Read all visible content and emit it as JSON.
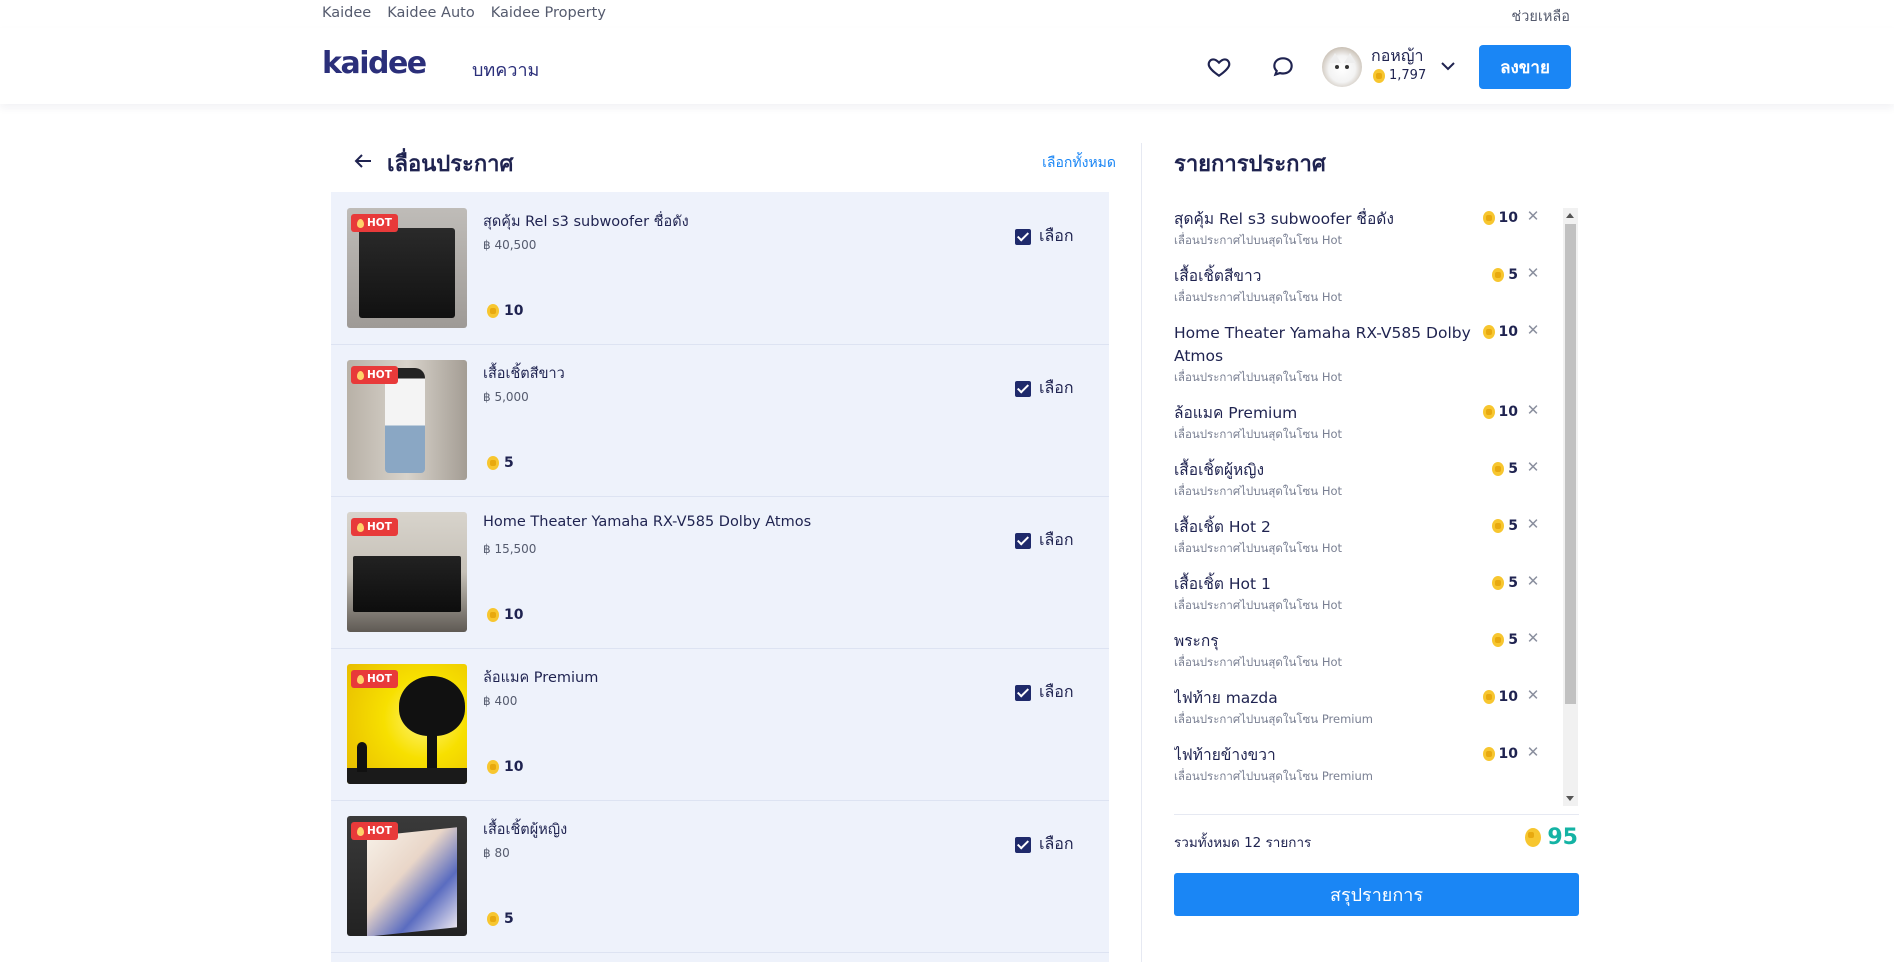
{
  "topbar": {
    "links": [
      "Kaidee",
      "Kaidee Auto",
      "Kaidee Property"
    ],
    "help": "ช่วยเหลือ"
  },
  "header": {
    "logo": "kaidee",
    "nav_articles": "บทความ",
    "user_name": "กอหญ้า",
    "user_coins": "1,797",
    "post_button": "ลงขาย",
    "icons": [
      "heart-icon",
      "chat-icon",
      "chevron-down-icon"
    ]
  },
  "left": {
    "title": "เลื่อนประกาศ",
    "select_all": "เลือกทั้งหมด",
    "items": [
      {
        "title": "สุดคุ้ม Rel s3 subwoofer ชื่อดัง",
        "price": "฿ 40,500",
        "coins": "10",
        "badge": "HOT",
        "check_label": "เลือก",
        "checked": true
      },
      {
        "title": "เสื้อเชิ้ตสีขาว",
        "price": "฿ 5,000",
        "coins": "5",
        "badge": "HOT",
        "check_label": "เลือก",
        "checked": true
      },
      {
        "title": "Home Theater Yamaha RX-V585 Dolby Atmos",
        "price": "฿ 15,500",
        "coins": "10",
        "badge": "HOT",
        "check_label": "เลือก",
        "checked": true
      },
      {
        "title": "ล้อแมค Premium",
        "price": "฿ 400",
        "coins": "10",
        "badge": "HOT",
        "check_label": "เลือก",
        "checked": true
      },
      {
        "title": "เสื้อเชิ้ตผู้หญิง",
        "price": "฿ 80",
        "coins": "5",
        "badge": "HOT",
        "check_label": "เลือก",
        "checked": true
      }
    ]
  },
  "right": {
    "title": "รายการประกาศ",
    "items": [
      {
        "title": "สุดคุ้ม Rel s3 subwoofer ชื่อดัง",
        "sub": "เลื่อนประกาศไปบนสุดในโซน Hot",
        "coins": "10"
      },
      {
        "title": "เสื้อเชิ้ตสีขาว",
        "sub": "เลื่อนประกาศไปบนสุดในโซน Hot",
        "coins": "5"
      },
      {
        "title": "Home Theater Yamaha RX-V585 Dolby Atmos",
        "sub": "เลื่อนประกาศไปบนสุดในโซน Hot",
        "coins": "10"
      },
      {
        "title": "ล้อแมค Premium",
        "sub": "เลื่อนประกาศไปบนสุดในโซน Hot",
        "coins": "10"
      },
      {
        "title": "เสื้อเชิ้ตผู้หญิง",
        "sub": "เลื่อนประกาศไปบนสุดในโซน Hot",
        "coins": "5"
      },
      {
        "title": "เสื้อเชิ้ต Hot 2",
        "sub": "เลื่อนประกาศไปบนสุดในโซน Hot",
        "coins": "5"
      },
      {
        "title": "เสื้อเชิ้ต Hot 1",
        "sub": "เลื่อนประกาศไปบนสุดในโซน Hot",
        "coins": "5"
      },
      {
        "title": "พระกรุ",
        "sub": "เลื่อนประกาศไปบนสุดในโซน Hot",
        "coins": "5"
      },
      {
        "title": "ไฟท้าย mazda",
        "sub": "เลื่อนประกาศไปบนสุดในโซน Premium",
        "coins": "10"
      },
      {
        "title": "ไฟท้ายข้างขวา",
        "sub": "เลื่อนประกาศไปบนสุดในโซน Premium",
        "coins": "10"
      }
    ],
    "total_label": "รวมทั้งหมด 12 รายการ",
    "total_coins": "95",
    "summary_button": "สรุปรายการ"
  },
  "colors": {
    "primary": "#1a86f5",
    "navy": "#1f2350",
    "hot_badge": "#e83a3a",
    "total": "#14b3a4",
    "list_bg": "#eef2fb"
  }
}
